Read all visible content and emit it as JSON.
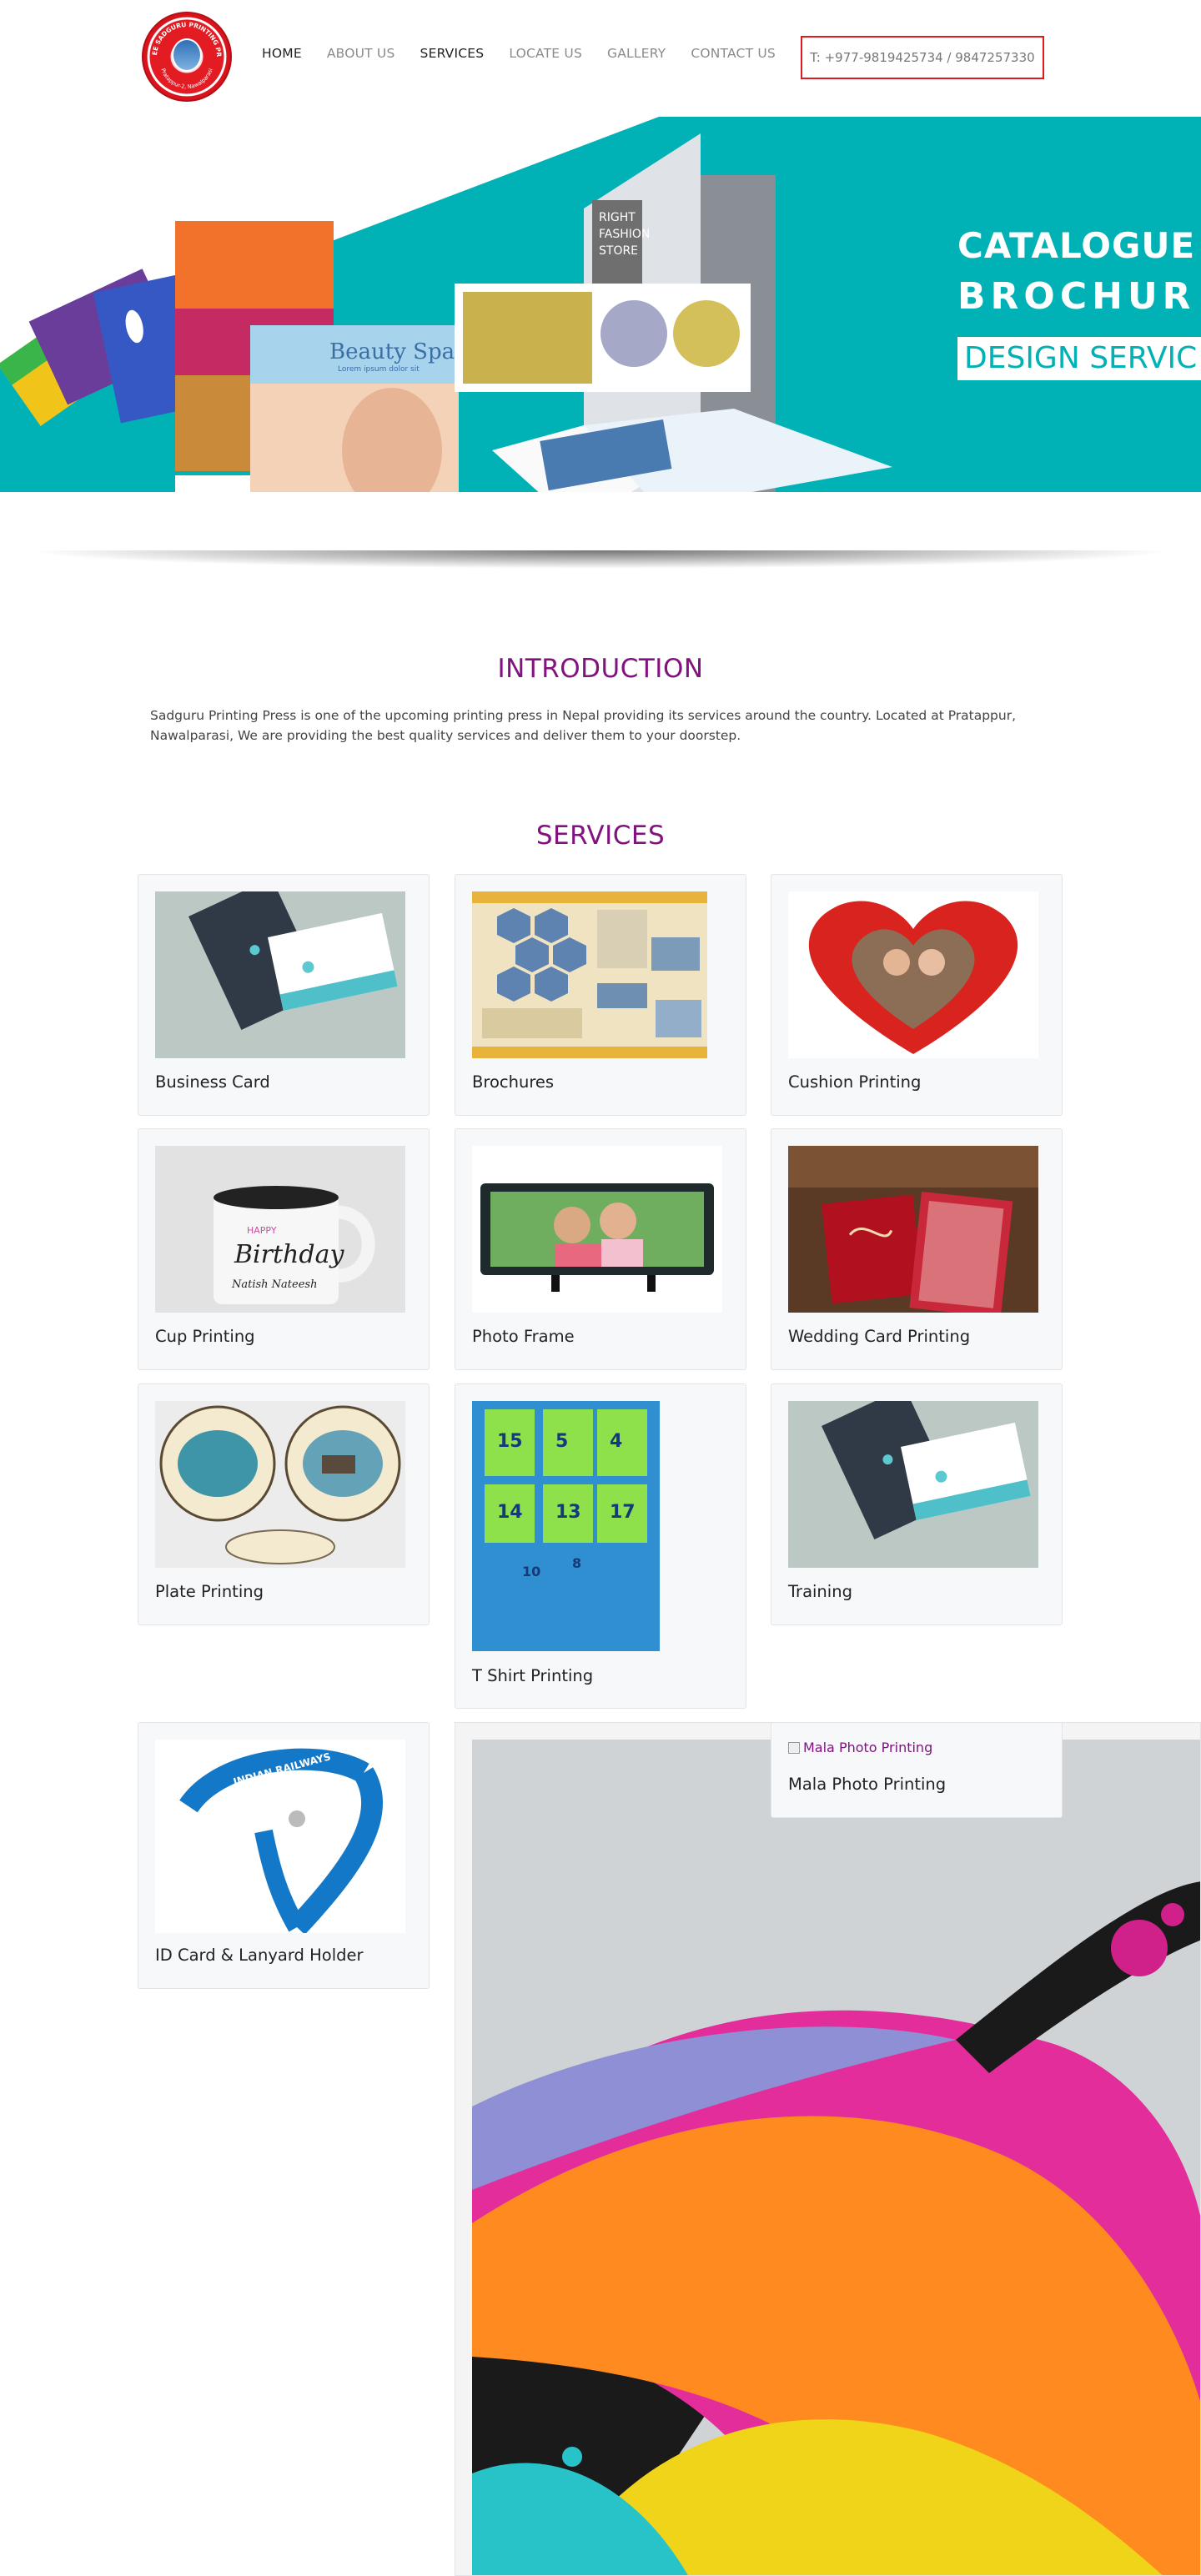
{
  "header": {
    "nav": [
      {
        "label": "HOME"
      },
      {
        "label": "ABOUT US"
      },
      {
        "label": "SERVICES"
      },
      {
        "label": "LOCATE US"
      },
      {
        "label": "GALLERY"
      },
      {
        "label": "CONTACT US"
      }
    ],
    "phone": "T: +977-9819425734 / 9847257330"
  },
  "logo": {
    "icon": "press-logo-icon",
    "ring_text_top": "SHREE SADGURU PRINTING PRESS",
    "ring_text_bottom": "Pratappur-2, Nawalparasi"
  },
  "hero": {
    "line1": "CATALOGUE",
    "line2": "BROCHUR",
    "line3": "DESIGN SERVIC",
    "spa_text": "Beauty Spa",
    "spa_sub": "Lorem ipsum dolor sit",
    "fashion_text": "RIGHT FASHION STORE",
    "slides": 5,
    "active_slide": 1,
    "colors": {
      "teal": "#00b1b5"
    }
  },
  "intro": {
    "title": "INTRODUCTION",
    "text": "Sadguru Printing Press is one of the upcoming printing press in Nepal providing its services around the country. Located at Pratappur, Nawalparasi, We are providing the best quality services and deliver them to your doorstep."
  },
  "services": {
    "title": "SERVICES",
    "items": [
      {
        "label": "Business Card",
        "icon": "business-card-image"
      },
      {
        "label": "Brochures",
        "icon": "brochure-image"
      },
      {
        "label": "Cushion Printing",
        "icon": "heart-cushion-image"
      },
      {
        "label": "Cup Printing",
        "icon": "mug-image",
        "mug_text_1": "HAPPY",
        "mug_text_2": "Birthday",
        "mug_text_3": "Natish Nateesh"
      },
      {
        "label": "Photo Frame",
        "icon": "photo-frame-image"
      },
      {
        "label": "Wedding Card Printing",
        "icon": "wedding-card-image"
      },
      {
        "label": "Plate Printing",
        "icon": "plates-image"
      },
      {
        "label": "T Shirt Printing",
        "icon": "tshirt-image"
      },
      {
        "label": "Training",
        "icon": "business-card-image"
      },
      {
        "label": "ID Card & Lanyard Holder",
        "icon": "lanyard-image",
        "lanyard_text": "INDIAN RAILWAYS"
      },
      {
        "label": "Mala Photo Printing",
        "icon": "broken-image-icon",
        "alt": "Mala Photo Printing"
      }
    ]
  },
  "colors": {
    "accent": "#82127f",
    "phone_border": "#e0181f",
    "card_bg": "#f7f8fa"
  }
}
